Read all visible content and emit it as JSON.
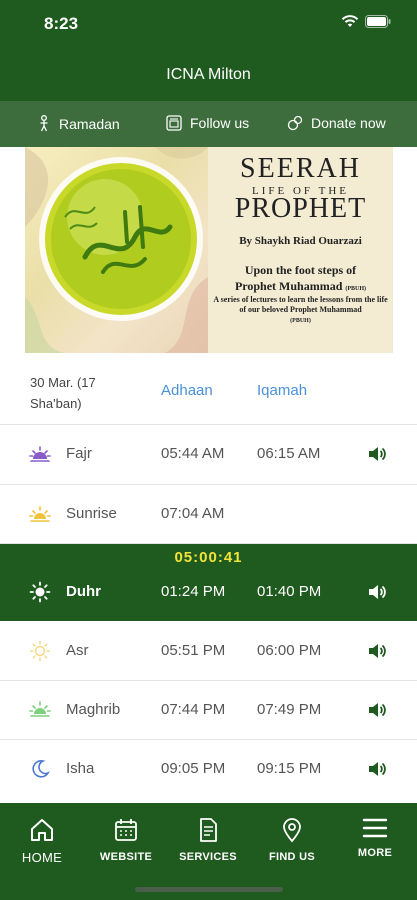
{
  "status_bar": {
    "time": "8:23"
  },
  "app": {
    "title": "ICNA Milton"
  },
  "actions": [
    {
      "label": "Ramadan",
      "icon": "person-icon"
    },
    {
      "label": "Follow us",
      "icon": "social-icon"
    },
    {
      "label": "Donate now",
      "icon": "donate-icon"
    }
  ],
  "banner": {
    "title_line1": "SEERAH",
    "title_line2": "LIFE OF THE",
    "title_line3": "PROPHET",
    "byline": "By Shaykh Riad Ouarzazi",
    "subtitle_line1": "Upon the foot steps of",
    "subtitle_line2": "Prophet Muhammad",
    "subtitle_pbuh": "(PBUH)",
    "description": "A series of lectures to learn the lessons from the life of our beloved Prophet Muhammad",
    "description_pbuh": "(PBUH)"
  },
  "schedule": {
    "date": "30 Mar. (17 Sha'ban)",
    "adhaan_header": "Adhaan",
    "iqamah_header": "Iqamah",
    "countdown": "05:00:41",
    "prayers": [
      {
        "name": "Fajr",
        "adhaan": "05:44 AM",
        "iqamah": "06:15 AM",
        "icon": "fajr-icon",
        "sound": true
      },
      {
        "name": "Sunrise",
        "adhaan": "07:04 AM",
        "iqamah": "",
        "icon": "sunrise-icon",
        "sound": false
      },
      {
        "name": "Duhr",
        "adhaan": "01:24 PM",
        "iqamah": "01:40 PM",
        "icon": "sun-icon",
        "sound": true,
        "active": true
      },
      {
        "name": "Asr",
        "adhaan": "05:51 PM",
        "iqamah": "06:00 PM",
        "icon": "asr-sun-icon",
        "sound": true
      },
      {
        "name": "Maghrib",
        "adhaan": "07:44 PM",
        "iqamah": "07:49 PM",
        "icon": "sunset-icon",
        "sound": true
      },
      {
        "name": "Isha",
        "adhaan": "09:05 PM",
        "iqamah": "09:15 PM",
        "icon": "moon-icon",
        "sound": true
      }
    ]
  },
  "tabs": [
    {
      "label": "HOME",
      "icon": "home-icon"
    },
    {
      "label": "WEBSITE",
      "icon": "calendar-icon"
    },
    {
      "label": "SERVICES",
      "icon": "document-icon"
    },
    {
      "label": "FIND US",
      "icon": "location-pin-icon"
    },
    {
      "label": "MORE",
      "icon": "menu-icon"
    }
  ],
  "colors": {
    "primary_green": "#1f5a1f",
    "action_bar_green": "#3d6d3d",
    "countdown_yellow": "#f2e33a",
    "header_blue": "#4a90d9",
    "sound_icon_green": "#1f5a1f"
  }
}
